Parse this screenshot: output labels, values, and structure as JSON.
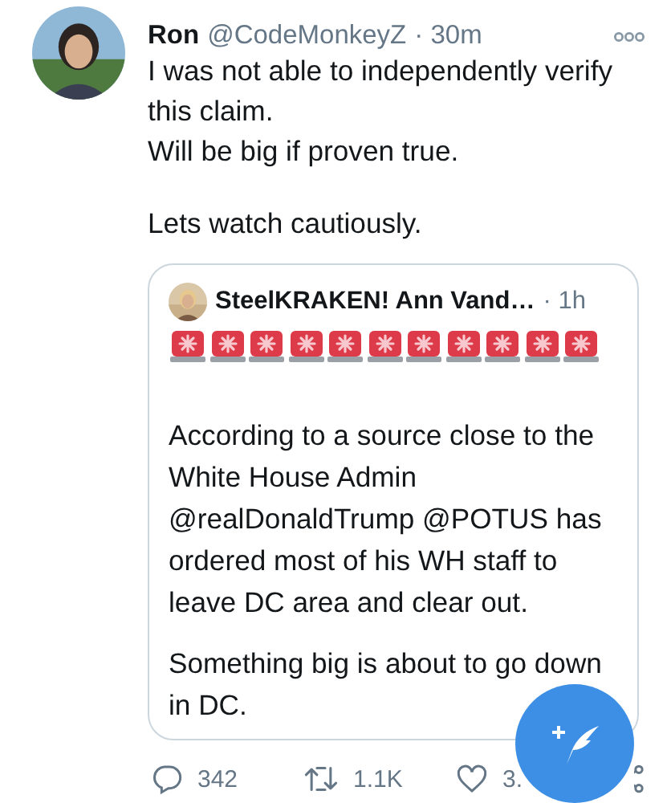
{
  "tweet": {
    "author": {
      "name": "Ron",
      "handle": "@CodeMonkeyZ",
      "time": "· 30m"
    },
    "paragraphs": [
      "I was not able to independently verify this claim.\nWill be big if proven true.",
      "Lets watch cautiously."
    ],
    "quote": {
      "author": {
        "name": "SteelKRAKEN! Ann Vand…",
        "time": "· 1h"
      },
      "emoji": [
        {
          "kind": "siren"
        },
        {
          "kind": "siren"
        },
        {
          "kind": "siren"
        },
        {
          "kind": "siren"
        },
        {
          "kind": "siren"
        },
        {
          "kind": "siren"
        },
        {
          "kind": "siren"
        },
        {
          "kind": "siren"
        },
        {
          "kind": "siren"
        },
        {
          "kind": "siren"
        },
        {
          "kind": "siren"
        }
      ],
      "paragraphs": [
        "According to a source close to the White House Admin @realDonaldTrump @POTUS has ordered most of his WH staff to leave DC area and clear out.",
        "Something big is about to go down in DC."
      ]
    },
    "actions": [
      {
        "kind": "reply",
        "count": "342"
      },
      {
        "kind": "retweet",
        "count": "1.1K"
      },
      {
        "kind": "like",
        "count": "3."
      },
      {
        "kind": "share"
      }
    ]
  }
}
